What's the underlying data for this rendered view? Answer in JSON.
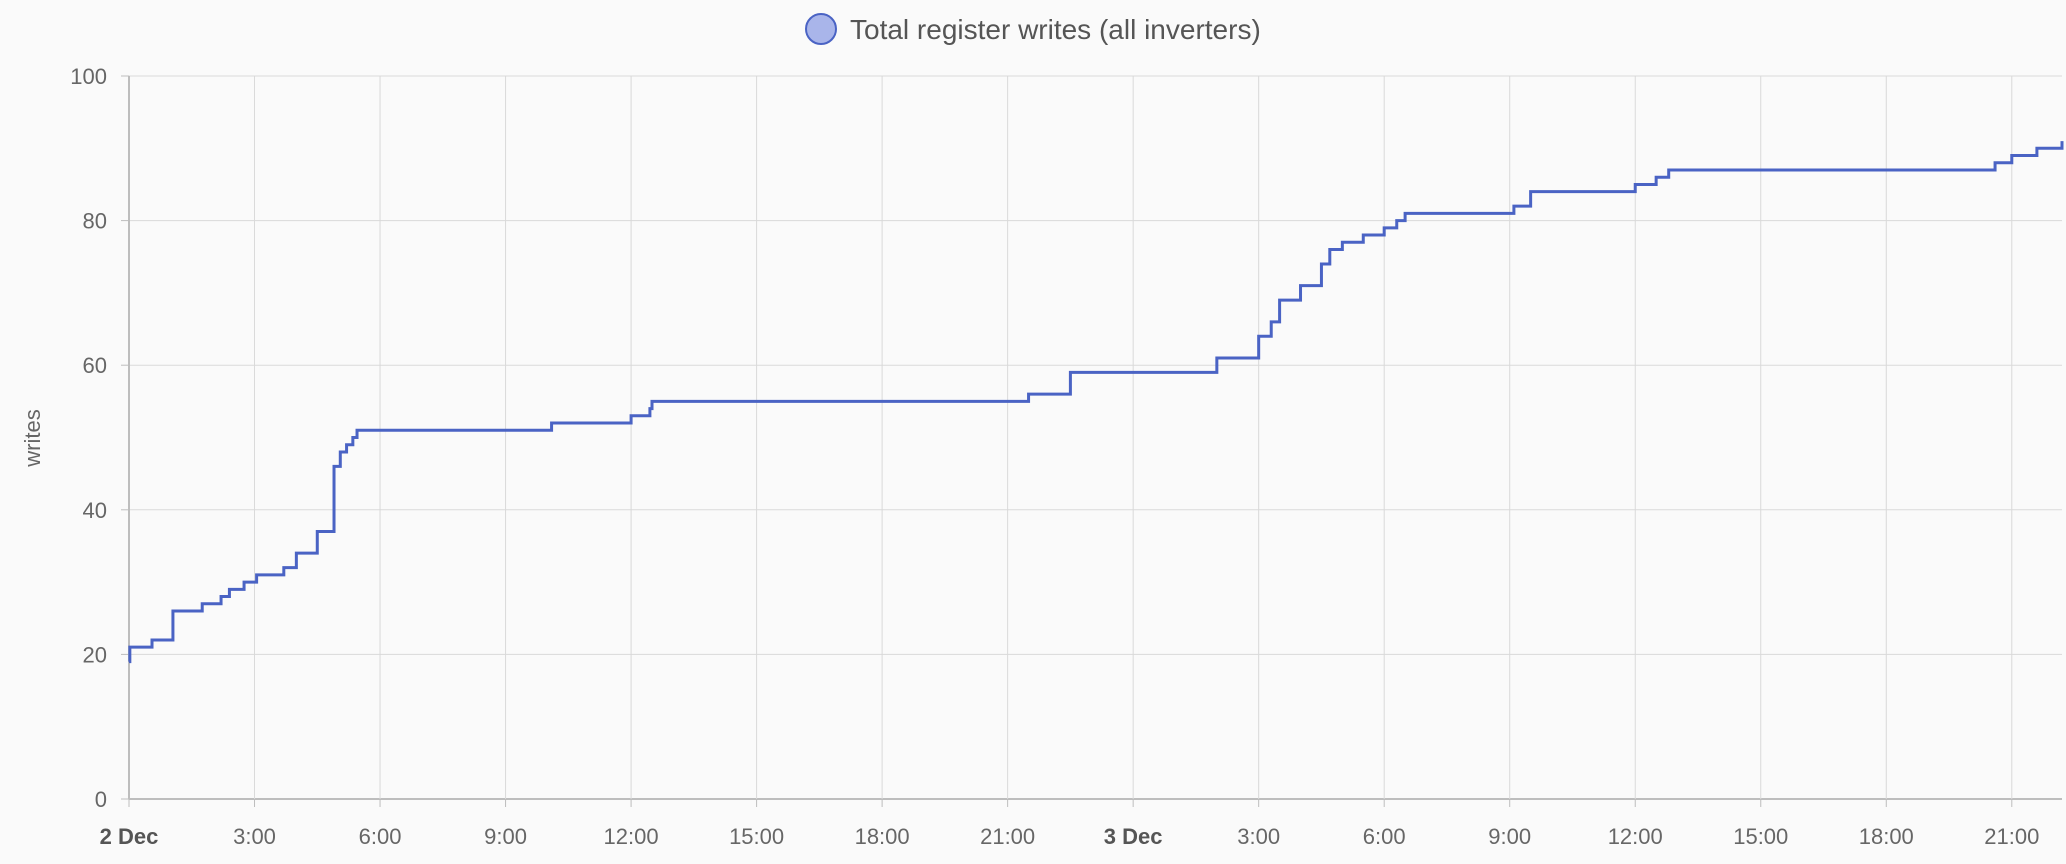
{
  "legend": {
    "label": "Total register writes (all inverters)"
  },
  "colors": {
    "line": "#4a63c4",
    "legend_fill": "#a9b5ea",
    "legend_stroke": "#4a63c4",
    "grid": "#d9d9d9",
    "axis": "#bdbdbd"
  },
  "chart_data": {
    "type": "line",
    "step": true,
    "ylabel": "writes",
    "xlabel": "",
    "ylim": [
      0,
      100
    ],
    "yticks": [
      0,
      20,
      40,
      60,
      80,
      100
    ],
    "x_unit": "hours since 2 Dec 00:00",
    "xlim": [
      0,
      46.2
    ],
    "xticks": [
      {
        "x": 0,
        "label": "2 Dec",
        "bold": true
      },
      {
        "x": 3,
        "label": "3:00"
      },
      {
        "x": 6,
        "label": "6:00"
      },
      {
        "x": 9,
        "label": "9:00"
      },
      {
        "x": 12,
        "label": "12:00"
      },
      {
        "x": 15,
        "label": "15:00"
      },
      {
        "x": 18,
        "label": "18:00"
      },
      {
        "x": 21,
        "label": "21:00"
      },
      {
        "x": 24,
        "label": "3 Dec",
        "bold": true
      },
      {
        "x": 27,
        "label": "3:00"
      },
      {
        "x": 30,
        "label": "6:00"
      },
      {
        "x": 33,
        "label": "9:00"
      },
      {
        "x": 36,
        "label": "12:00"
      },
      {
        "x": 39,
        "label": "15:00"
      },
      {
        "x": 42,
        "label": "18:00"
      },
      {
        "x": 45,
        "label": "21:00"
      }
    ],
    "series": [
      {
        "name": "Total register writes (all inverters)",
        "points": [
          [
            0.0,
            19
          ],
          [
            0.02,
            21
          ],
          [
            0.55,
            22
          ],
          [
            1.05,
            26
          ],
          [
            1.75,
            27
          ],
          [
            2.2,
            28
          ],
          [
            2.4,
            29
          ],
          [
            2.75,
            30
          ],
          [
            3.05,
            31
          ],
          [
            3.7,
            32
          ],
          [
            4.0,
            34
          ],
          [
            4.5,
            37
          ],
          [
            4.9,
            46
          ],
          [
            5.05,
            48
          ],
          [
            5.2,
            49
          ],
          [
            5.35,
            50
          ],
          [
            5.45,
            51
          ],
          [
            10.1,
            52
          ],
          [
            12.0,
            53
          ],
          [
            12.45,
            54
          ],
          [
            12.5,
            55
          ],
          [
            21.5,
            56
          ],
          [
            22.5,
            59
          ],
          [
            26.0,
            61
          ],
          [
            27.0,
            64
          ],
          [
            27.3,
            66
          ],
          [
            27.5,
            69
          ],
          [
            28.0,
            71
          ],
          [
            28.5,
            74
          ],
          [
            28.7,
            76
          ],
          [
            29.0,
            77
          ],
          [
            29.5,
            78
          ],
          [
            30.0,
            79
          ],
          [
            30.3,
            80
          ],
          [
            30.5,
            81
          ],
          [
            33.1,
            82
          ],
          [
            33.5,
            84
          ],
          [
            36.0,
            85
          ],
          [
            36.5,
            86
          ],
          [
            36.8,
            87
          ],
          [
            44.6,
            88
          ],
          [
            45.0,
            89
          ],
          [
            45.6,
            90
          ],
          [
            46.2,
            91
          ]
        ]
      }
    ]
  }
}
